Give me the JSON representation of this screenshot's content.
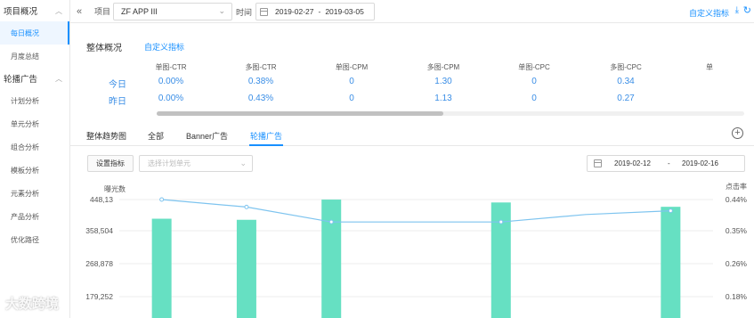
{
  "sidebar": {
    "groups": [
      {
        "label": "项目概况",
        "items": [
          {
            "label": "每日概况",
            "active": true
          },
          {
            "label": "月度总结"
          }
        ]
      },
      {
        "label": "轮播广告",
        "items": [
          {
            "label": "计划分析"
          },
          {
            "label": "单元分析"
          },
          {
            "label": "组合分析"
          },
          {
            "label": "模板分析"
          },
          {
            "label": "元素分析"
          },
          {
            "label": "产品分析"
          },
          {
            "label": "优化路径"
          }
        ]
      }
    ]
  },
  "topbar": {
    "project_label": "项目",
    "project_value": "ZF APP III",
    "time_label": "时间",
    "date_start": "2019-02-27",
    "date_sep": "-",
    "date_end": "2019-03-05",
    "custom_metrics": "自定义指标"
  },
  "overview": {
    "title": "整体概况",
    "custom_link": "自定义指标",
    "columns": [
      "单图-CTR",
      "多图-CTR",
      "单图-CPM",
      "多图-CPM",
      "单图-CPC",
      "多图-CPC",
      "单"
    ],
    "rows": [
      {
        "label": "今日",
        "values": [
          "0.00%",
          "0.38%",
          "0",
          "1.30",
          "0",
          "0.34"
        ]
      },
      {
        "label": "昨日",
        "values": [
          "0.00%",
          "0.43%",
          "0",
          "1.13",
          "0",
          "0.27"
        ]
      }
    ]
  },
  "trend": {
    "title": "整体趋势图",
    "tabs": [
      {
        "label": "全部"
      },
      {
        "label": "Banner广告"
      },
      {
        "label": "轮播广告",
        "active": true
      }
    ],
    "set_button": "设置指标",
    "plan_placeholder": "选择计划单元",
    "range_start": "2019-02-12",
    "range_sep": "-",
    "range_end": "2019-02-16"
  },
  "chart_data": {
    "type": "bar",
    "left_axis_label": "曝光数",
    "right_axis_label": "点击率",
    "left_ticks": [
      "448,13",
      "358,504",
      "268,878",
      "179,252"
    ],
    "left_tick_values": [
      448130,
      358504,
      268878,
      179252
    ],
    "right_ticks": [
      "0.44%",
      "0.35%",
      "0.26%",
      "0.18%"
    ],
    "right_tick_values": [
      0.44,
      0.35,
      0.26,
      0.18
    ],
    "series": [
      {
        "name": "曝光数",
        "kind": "bar",
        "color": "#66e0c2",
        "values": [
          395000,
          392000,
          448000,
          0,
          440000,
          0,
          428000
        ]
      },
      {
        "name": "点击率",
        "kind": "line",
        "color": "#7ec4ef",
        "values": [
          0.44,
          0.42,
          0.38,
          0.38,
          0.38,
          0.4,
          0.41
        ]
      }
    ],
    "bar_visible": [
      true,
      true,
      true,
      false,
      true,
      false,
      true
    ],
    "line_points_visible": [
      true,
      true,
      true,
      false,
      true,
      false,
      true
    ]
  },
  "watermark": "大数跨境"
}
